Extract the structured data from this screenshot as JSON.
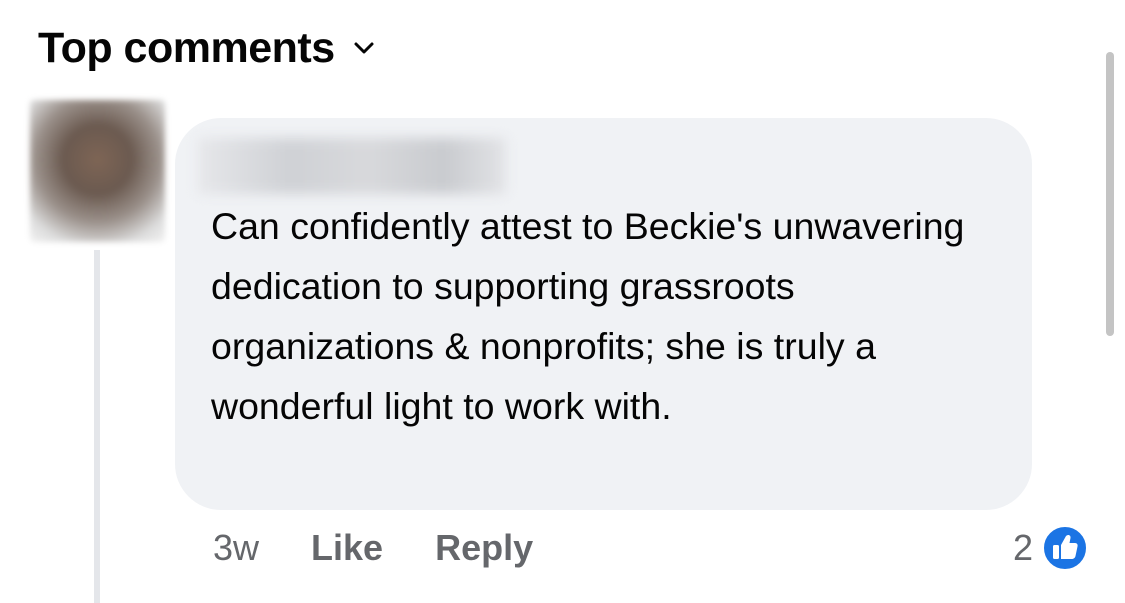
{
  "header": {
    "sort_label": "Top comments",
    "sort_icon": "chevron-down-icon"
  },
  "comment": {
    "author_name": "",
    "text": "Can confidently attest to Beckie's unwavering dedication to supporting grassroots organizations & nonprofits; she is truly a wonderful light to work with.",
    "timestamp": "3w",
    "like_label": "Like",
    "reply_label": "Reply",
    "reaction_count": "2",
    "reaction_icon": "thumbs-up-icon"
  },
  "colors": {
    "bubble_bg": "#f0f2f5",
    "meta_text": "#65676b",
    "like_blue": "#1b74e4"
  }
}
